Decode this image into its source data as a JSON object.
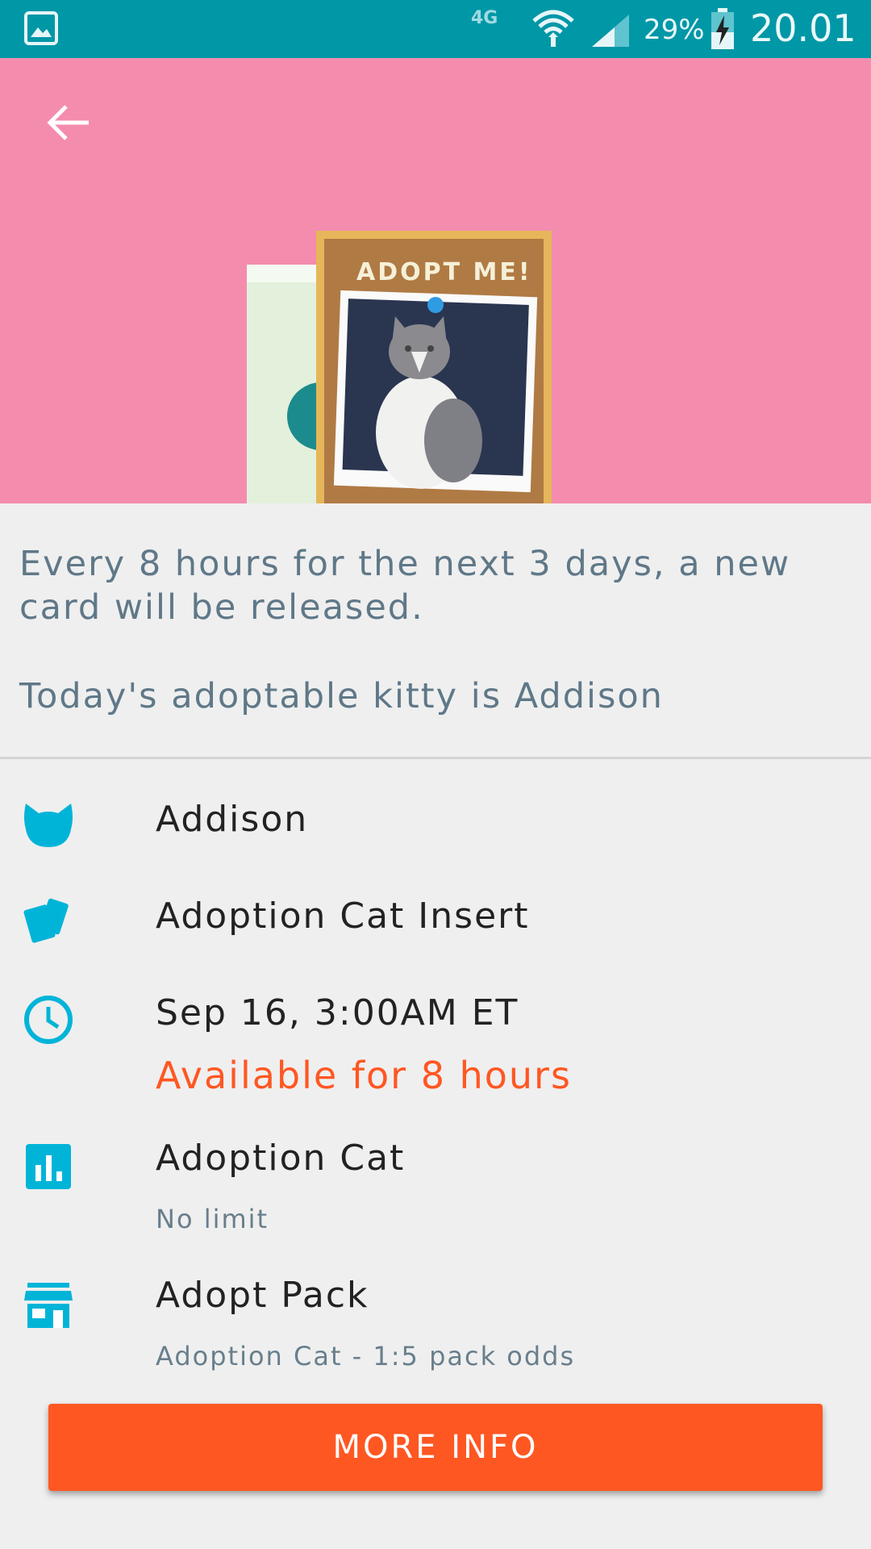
{
  "status_bar": {
    "network_type": "4G",
    "battery_percent": "29%",
    "time": "20.01"
  },
  "hero": {
    "card_heading": "ADOPT ME!",
    "background_color": "#f48cae"
  },
  "description": {
    "release_text": "Every 8 hours for the next 3 days, a new card will be released.",
    "kitty_text": "Today's adoptable kitty is Addison"
  },
  "details": {
    "name": {
      "title": "Addison",
      "icon": "cat-icon"
    },
    "card_set": {
      "title": "Adoption Cat Insert",
      "icon": "cards-icon"
    },
    "release": {
      "title": "Sep 16, 3:00AM ET",
      "availability": "Available for 8 hours",
      "icon": "clock-icon"
    },
    "limit": {
      "title": "Adoption Cat",
      "subtitle": "No limit",
      "icon": "bar-chart-icon"
    },
    "pack": {
      "title": "Adopt Pack",
      "subtitle": "Adoption Cat - 1:5 pack odds",
      "icon": "store-icon"
    }
  },
  "actions": {
    "more_info_label": "MORE INFO"
  },
  "colors": {
    "accent": "#00b4d8",
    "status_bar": "#0097a7",
    "button": "#ff5722",
    "alert_text": "#ff5722"
  }
}
